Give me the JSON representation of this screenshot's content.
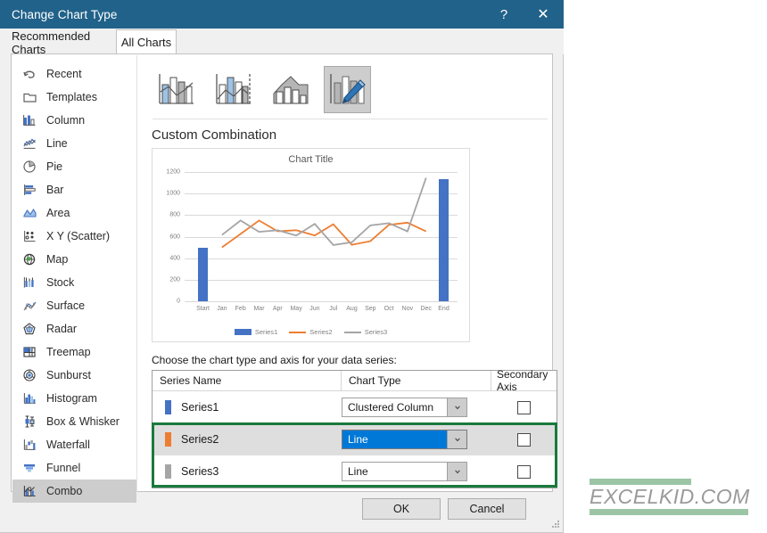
{
  "window": {
    "title": "Change Chart Type",
    "help_label": "?",
    "close_label": "✕"
  },
  "tabs": [
    {
      "label": "Recommended Charts",
      "active": false
    },
    {
      "label": "All Charts",
      "active": true
    }
  ],
  "sidebar": {
    "items": [
      {
        "label": "Recent",
        "icon": "recent-icon",
        "selected": false
      },
      {
        "label": "Templates",
        "icon": "templates-icon",
        "selected": false
      },
      {
        "label": "Column",
        "icon": "column-icon",
        "selected": false
      },
      {
        "label": "Line",
        "icon": "line-icon",
        "selected": false
      },
      {
        "label": "Pie",
        "icon": "pie-icon",
        "selected": false
      },
      {
        "label": "Bar",
        "icon": "bar-icon",
        "selected": false
      },
      {
        "label": "Area",
        "icon": "area-icon",
        "selected": false
      },
      {
        "label": "X Y (Scatter)",
        "icon": "scatter-icon",
        "selected": false
      },
      {
        "label": "Map",
        "icon": "map-icon",
        "selected": false
      },
      {
        "label": "Stock",
        "icon": "stock-icon",
        "selected": false
      },
      {
        "label": "Surface",
        "icon": "surface-icon",
        "selected": false
      },
      {
        "label": "Radar",
        "icon": "radar-icon",
        "selected": false
      },
      {
        "label": "Treemap",
        "icon": "treemap-icon",
        "selected": false
      },
      {
        "label": "Sunburst",
        "icon": "sunburst-icon",
        "selected": false
      },
      {
        "label": "Histogram",
        "icon": "histogram-icon",
        "selected": false
      },
      {
        "label": "Box & Whisker",
        "icon": "box-whisker-icon",
        "selected": false
      },
      {
        "label": "Waterfall",
        "icon": "waterfall-icon",
        "selected": false
      },
      {
        "label": "Funnel",
        "icon": "funnel-icon",
        "selected": false
      },
      {
        "label": "Combo",
        "icon": "combo-icon",
        "selected": true
      }
    ]
  },
  "thumbnails": [
    {
      "name": "clustered-column-line",
      "selected": false
    },
    {
      "name": "clustered-column-line-secondary",
      "selected": false
    },
    {
      "name": "stacked-area-clustered-column",
      "selected": false
    },
    {
      "name": "custom-combination",
      "selected": true
    }
  ],
  "preview": {
    "subtitle": "Custom Combination"
  },
  "chart_data": {
    "type": "line",
    "title": "Chart Title",
    "xlabel": "",
    "ylabel": "",
    "ylim": [
      0,
      1200
    ],
    "yticks": [
      0,
      200,
      400,
      600,
      800,
      1000,
      1200
    ],
    "grid": true,
    "legend_position": "bottom",
    "categories": [
      "Start",
      "Jan",
      "Feb",
      "Mar",
      "Apr",
      "May",
      "Jun",
      "Jul",
      "Aug",
      "Sep",
      "Oct",
      "Nov",
      "Dec",
      "End"
    ],
    "series": [
      {
        "name": "Series1",
        "type": "bar",
        "color": "#4472c4",
        "values": [
          500,
          null,
          null,
          null,
          null,
          null,
          null,
          null,
          null,
          null,
          null,
          null,
          null,
          1135
        ]
      },
      {
        "name": "Series2",
        "type": "line",
        "color": "#ed7d31",
        "values": [
          null,
          500,
          625,
          750,
          650,
          660,
          612,
          715,
          525,
          558,
          710,
          730,
          652,
          null
        ]
      },
      {
        "name": "Series3",
        "type": "line",
        "color": "#a5a5a5",
        "values": [
          null,
          615,
          750,
          645,
          660,
          610,
          718,
          522,
          548,
          705,
          725,
          652,
          1145,
          null
        ]
      }
    ]
  },
  "series_table": {
    "instruction": "Choose the chart type and axis for your data series:",
    "columns": [
      "Series Name",
      "Chart Type",
      "Secondary Axis"
    ],
    "rows": [
      {
        "name": "Series1",
        "swatch": "#4472c4",
        "chart_type": "Clustered Column",
        "dropdown_active": false,
        "secondary_axis": false,
        "row_highlight": false
      },
      {
        "name": "Series2",
        "swatch": "#ed7d31",
        "chart_type": "Line",
        "dropdown_active": true,
        "secondary_axis": false,
        "row_highlight": true
      },
      {
        "name": "Series3",
        "swatch": "#a5a5a5",
        "chart_type": "Line",
        "dropdown_active": false,
        "secondary_axis": false,
        "row_highlight": false
      }
    ],
    "highlight_color": "#1a7a3c"
  },
  "footer": {
    "ok_label": "OK",
    "cancel_label": "Cancel"
  },
  "watermark": {
    "text": "EXCELKID.COM",
    "bar_color": "#9cc5a6"
  },
  "colors": {
    "titlebar": "#21628a",
    "accent_blue": "#0078d7",
    "series1": "#4472c4",
    "series2": "#ed7d31",
    "series3": "#a5a5a5",
    "highlight_green": "#1a7a3c"
  }
}
